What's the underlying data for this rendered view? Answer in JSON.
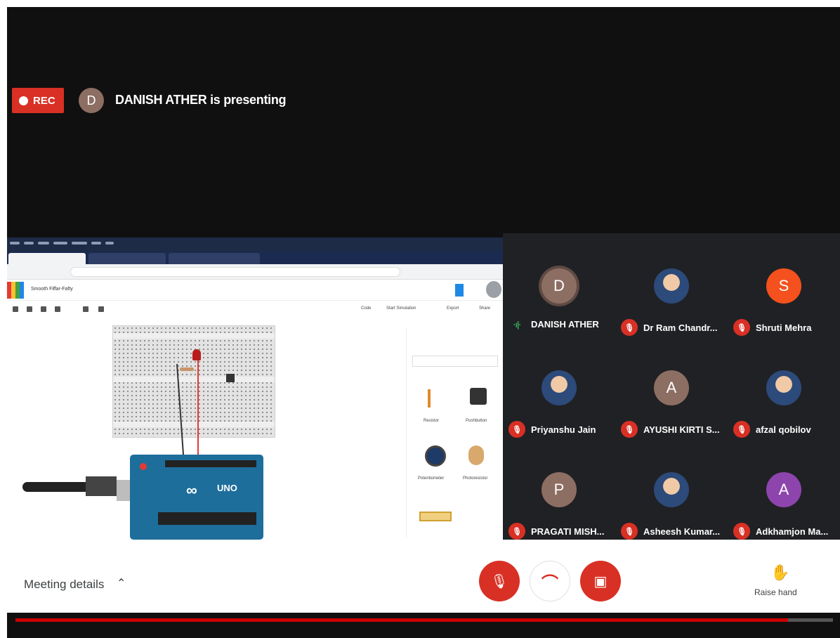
{
  "recording": {
    "label": "REC"
  },
  "presenter": {
    "initial": "D",
    "status_text": "DANISH ATHER is presenting"
  },
  "shared_app": {
    "project_title": "Smooth Fiffar-Fafty",
    "toolbar_right": [
      "Code",
      "Start Simulation",
      "Export",
      "Share"
    ],
    "component_labels": [
      "Resistor",
      "Pushbutton",
      "Potentiometer",
      "Photoresistor"
    ],
    "board_logo": "∞",
    "board_name": "UNO"
  },
  "participants": [
    {
      "name": "DANISH ATHER",
      "initial": "D",
      "color": "#8d6e63",
      "mic": "speaking"
    },
    {
      "name": "Dr Ram Chandr...",
      "initial": "",
      "color": "",
      "mic": "muted"
    },
    {
      "name": "Shruti Mehra",
      "initial": "S",
      "color": "#f4511e",
      "mic": "muted"
    },
    {
      "name": "Priyanshu Jain",
      "initial": "",
      "color": "",
      "mic": "muted"
    },
    {
      "name": "AYUSHI KIRTI S...",
      "initial": "A",
      "color": "#8d6e63",
      "mic": "muted"
    },
    {
      "name": "afzal qobilov",
      "initial": "",
      "color": "",
      "mic": "muted"
    },
    {
      "name": "PRAGATI MISH...",
      "initial": "P",
      "color": "#8d6e63",
      "mic": "muted"
    },
    {
      "name": "Asheesh Kumar...",
      "initial": "",
      "color": "",
      "mic": "muted"
    },
    {
      "name": "Adkhamjon Ma...",
      "initial": "A",
      "color": "#8e44ad",
      "mic": "muted"
    }
  ],
  "controls": {
    "meeting_details": "Meeting details",
    "raise_hand": "Raise hand"
  },
  "video_progress": 0.945
}
